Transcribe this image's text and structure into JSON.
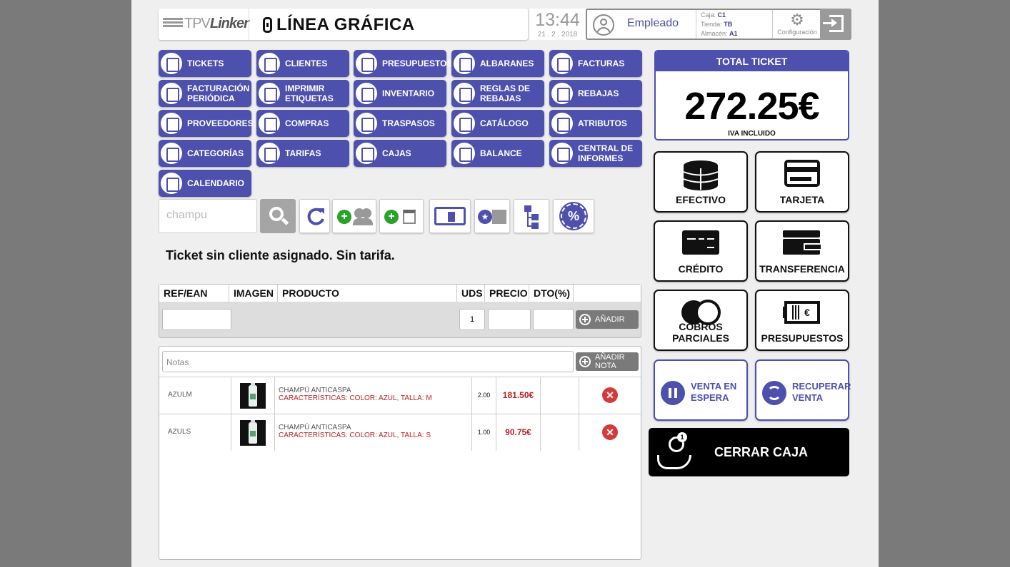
{
  "header": {
    "tpv_logo_light": "TPV",
    "tpv_logo_bold": "Linker",
    "company": "LÍNEA GRÁFICA",
    "time": "13:44",
    "date": "21 . 2 . 2018",
    "user": "Empleado",
    "caja_label": "Caja:",
    "caja_value": "C1",
    "tienda_label": "Tienda:",
    "tienda_value": "TB",
    "almacen_label": "Almacén:",
    "almacen_value": "A1",
    "config_label": "Configuración"
  },
  "nav": [
    {
      "label": "TICKETS",
      "icon": "ticket-icon"
    },
    {
      "label": "CLIENTES",
      "icon": "users-icon"
    },
    {
      "label": "PRESUPUESTOS",
      "icon": "budget-icon"
    },
    {
      "label": "ALBARANES",
      "icon": "delivery-note-icon"
    },
    {
      "label": "FACTURAS",
      "icon": "invoice-icon"
    },
    {
      "label": "FACTURACIÓN PERIÓDICA",
      "icon": "calendar-icon"
    },
    {
      "label": "IMPRIMIR ETIQUETAS",
      "icon": "printer-icon"
    },
    {
      "label": "INVENTARIO",
      "icon": "clipboard-icon"
    },
    {
      "label": "REGLAS DE REBAJAS",
      "icon": "discount-rules-icon"
    },
    {
      "label": "REBAJAS",
      "icon": "percent-icon"
    },
    {
      "label": "PROVEEDORES",
      "icon": "suppliers-icon"
    },
    {
      "label": "COMPRAS",
      "icon": "store-icon"
    },
    {
      "label": "TRASPASOS",
      "icon": "transfer-icon"
    },
    {
      "label": "CATÁLOGO",
      "icon": "book-icon"
    },
    {
      "label": "ATRIBUTOS",
      "icon": "list-icon"
    },
    {
      "label": "CATEGORÍAS",
      "icon": "tree-icon"
    },
    {
      "label": "TARIFAS",
      "icon": "calculator-icon"
    },
    {
      "label": "CAJAS",
      "icon": "cash-register-icon"
    },
    {
      "label": "BALANCE",
      "icon": "chart-icon"
    },
    {
      "label": "CENTRAL DE INFORMES",
      "icon": "pie-chart-icon"
    },
    {
      "label": "CALENDARIO",
      "icon": "calendar-icon"
    }
  ],
  "search": {
    "value": "champu"
  },
  "notice": "Ticket sin cliente asignado. Sin tarifa.",
  "entry": {
    "headers": [
      "REF/EAN",
      "IMAGEN",
      "PRODUCTO",
      "UDS",
      "PRECIO",
      "DTO(%)",
      ""
    ],
    "uds_value": "1",
    "add_label": "AÑADIR"
  },
  "notes": {
    "placeholder": "Notas",
    "add_label": "AÑADIR NOTA"
  },
  "lines": [
    {
      "ref": "AZULM",
      "product": "CHAMPÚ ANTICASPA",
      "caract": "CARACTERÍSTICAS: COLOR: AZUL, TALLA: M",
      "uds": "2.00",
      "price": "181.50€"
    },
    {
      "ref": "AZULS",
      "product": "CHAMPÚ ANTICASPA",
      "caract": "CARACTERÍSTICAS: COLOR: AZUL, TALLA: S",
      "uds": "1.00",
      "price": "90.75€"
    }
  ],
  "total": {
    "title": "TOTAL TICKET",
    "value": "272.25€",
    "iva": "IVA INCLUIDO"
  },
  "payments": {
    "efectivo": "EFECTIVO",
    "tarjeta": "TARJETA",
    "credito": "CRÉDITO",
    "transferencia": "TRANSFERENCIA",
    "cobros": "COBROS PARCIALES",
    "presupuestos": "PRESUPUESTOS"
  },
  "actions": {
    "espera": "VENTA EN ESPERA",
    "recuperar": "RECUPERAR VENTA",
    "cerrar": "CERRAR CAJA"
  },
  "colors": {
    "accent": "#4d50ad",
    "price": "#b22222",
    "delete": "#d43a3a"
  }
}
